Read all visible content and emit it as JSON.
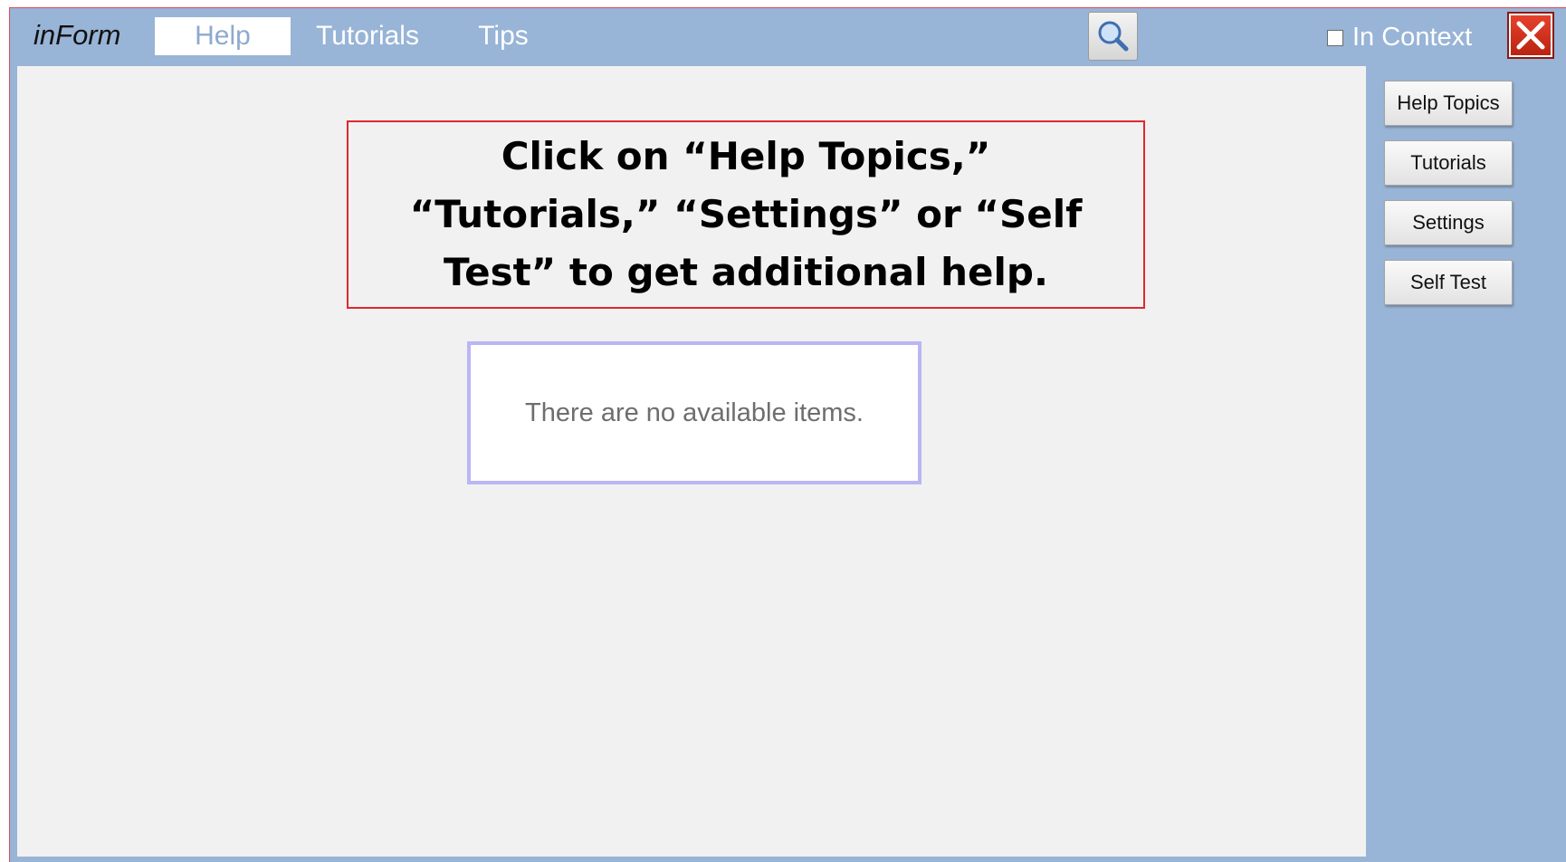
{
  "header": {
    "brand": "inForm",
    "tabs": [
      {
        "label": "Help",
        "active": true
      },
      {
        "label": "Tutorials",
        "active": false
      },
      {
        "label": "Tips",
        "active": false
      }
    ],
    "search_icon": "search-icon",
    "in_context_label": "In Context",
    "in_context_checked": false,
    "close_icon": "close-icon"
  },
  "callout": {
    "text": "Click on “Help Topics,” “Tutorials,” “Settings” or “Self Test” to get additional help."
  },
  "main": {
    "empty_message": "There are no available items."
  },
  "sidebar": {
    "buttons": [
      {
        "label": "Help Topics"
      },
      {
        "label": "Tutorials"
      },
      {
        "label": "Settings"
      },
      {
        "label": "Self Test"
      }
    ]
  },
  "colors": {
    "chrome": "#98b4d6",
    "content_bg": "#f1f1f1",
    "callout_border": "#e0282e",
    "empty_box_border": "#b9b6f5",
    "close_red": "#d1351f"
  }
}
